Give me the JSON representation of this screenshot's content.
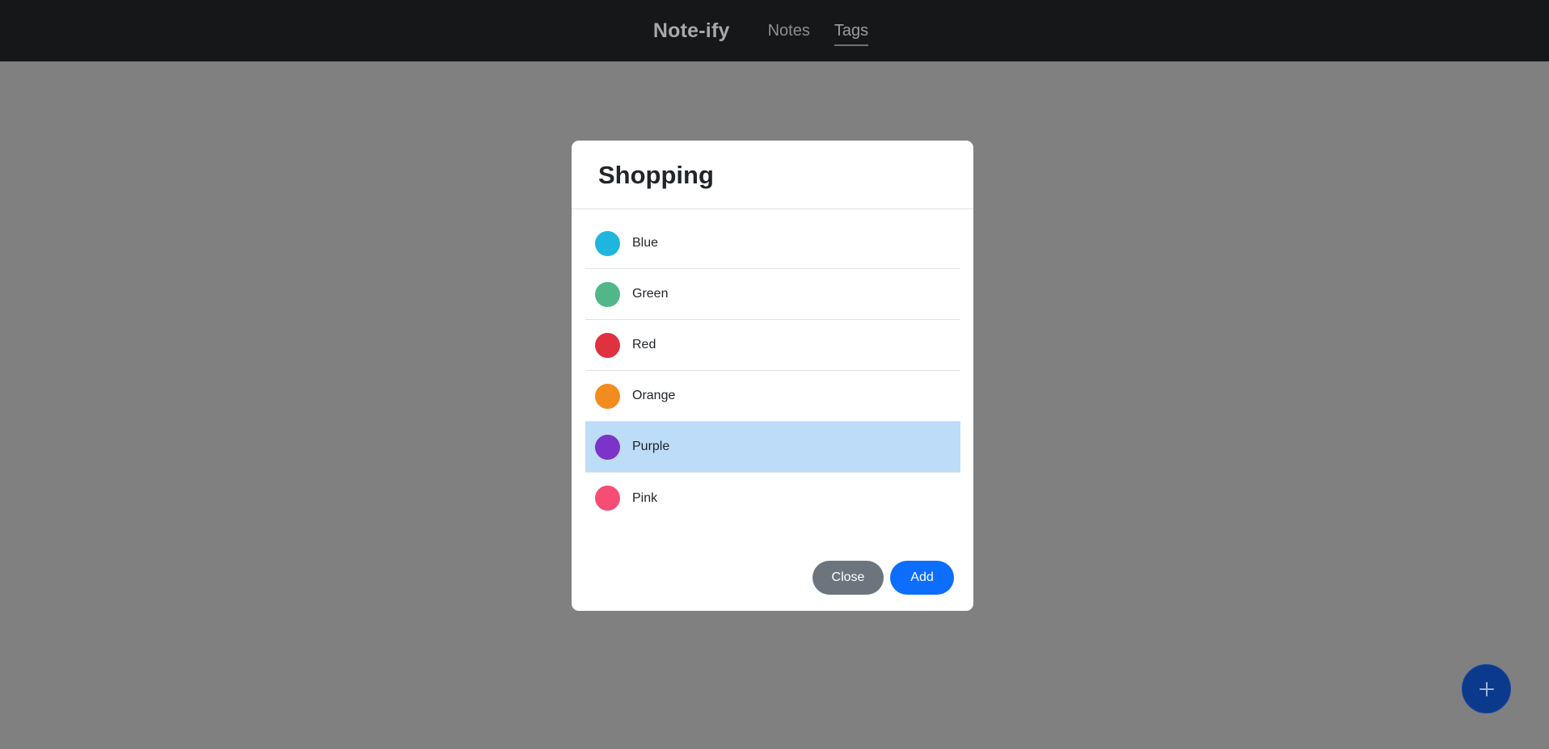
{
  "navbar": {
    "brand": "Note-ify",
    "links": [
      {
        "label": "Notes",
        "active": false
      },
      {
        "label": "Tags",
        "active": true
      }
    ]
  },
  "modal": {
    "title": "Shopping",
    "colors": [
      {
        "label": "Blue",
        "hex": "#1fb5df",
        "selected": false
      },
      {
        "label": "Green",
        "hex": "#52b788",
        "selected": false
      },
      {
        "label": "Red",
        "hex": "#e03140",
        "selected": false
      },
      {
        "label": "Orange",
        "hex": "#f28c1f",
        "selected": false
      },
      {
        "label": "Purple",
        "hex": "#7b33c9",
        "selected": true
      },
      {
        "label": "Pink",
        "hex": "#f74d74",
        "selected": false
      }
    ],
    "close_label": "Close",
    "add_label": "Add"
  },
  "fab": {
    "icon": "plus-icon"
  },
  "colors": {
    "navbar_bg": "#151719",
    "overlay": "#808080",
    "selected_row": "#bcdcf8",
    "primary": "#0d6efd",
    "secondary": "#6c757d"
  }
}
